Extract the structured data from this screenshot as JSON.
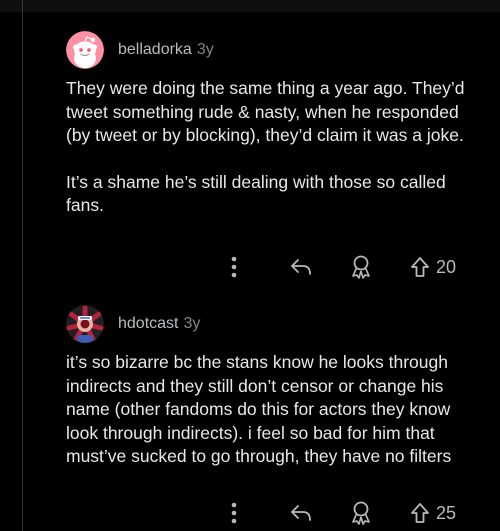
{
  "comments": [
    {
      "username": "belladorka",
      "age": "3y",
      "paragraphs": [
        "They were doing the same thing a year ago. They’d tweet something rude & nasty, when he responded (by tweet or by blocking), they’d claim it was a joke.",
        "It’s a shame he’s still dealing with those so called fans."
      ],
      "score": "20",
      "avatar_icon": "reddit-snoo-avatar-pink"
    },
    {
      "username": "hdotcast",
      "age": "3y",
      "paragraphs": [
        "it’s so bizarre bc the stans know he looks through indirects and they still don’t censor or change his name (other fandoms do this for actors they know look through indirects). i feel so bad for him that must’ve sucked to go through, they have no filters"
      ],
      "score": "25",
      "avatar_icon": "demogorgon-avatar"
    }
  ],
  "colors": {
    "background": "#000000",
    "text": "#e8e8e8",
    "muted": "#818384",
    "icon": "#b6b9bc"
  }
}
